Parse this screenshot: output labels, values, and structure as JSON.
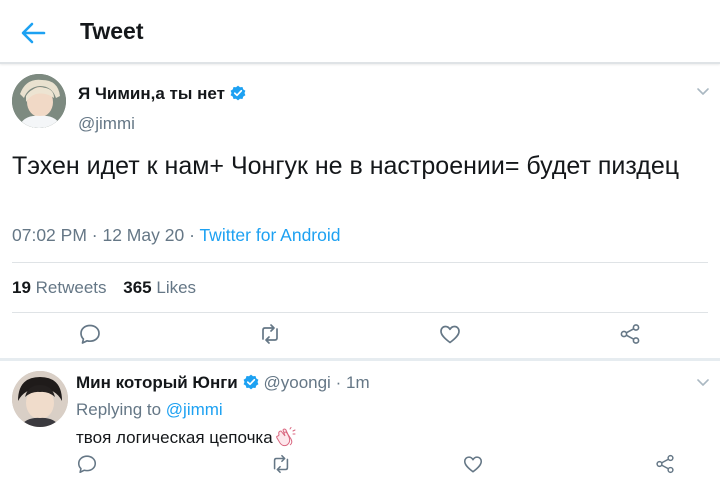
{
  "header": {
    "title": "Tweet",
    "back_icon": "back-arrow-icon",
    "accent": "#1da1f2"
  },
  "tweet": {
    "author_name": "Я Чимин,а ты нет",
    "handle": "@jimmi",
    "verified": true,
    "text": "Тэхен идет к нам+ Чонгук не в настроении= будет пиздец",
    "time": "07:02 PM",
    "date": "12 May 20",
    "source": "Twitter for Android",
    "retweets_count": "19",
    "retweets_label": "Retweets",
    "likes_count": "365",
    "likes_label": "Likes",
    "actions": [
      "reply-icon",
      "retweet-icon",
      "like-icon",
      "share-icon"
    ]
  },
  "reply": {
    "author_name": "Мин который Юнги",
    "handle": "@yoongi",
    "time_sep": "·",
    "time": "1m",
    "verified": true,
    "replying_label": "Replying to",
    "replying_to": "@jimmi",
    "text": "твоя логическая цепочка",
    "emoji": "clapping-hands-icon",
    "actions": [
      "reply-icon",
      "retweet-icon",
      "like-icon",
      "share-icon"
    ]
  },
  "colors": {
    "text_primary": "#14171a",
    "text_secondary": "#657786",
    "link": "#1da1f2",
    "verified": "#1da1f2",
    "divider": "#dfe3e6"
  }
}
